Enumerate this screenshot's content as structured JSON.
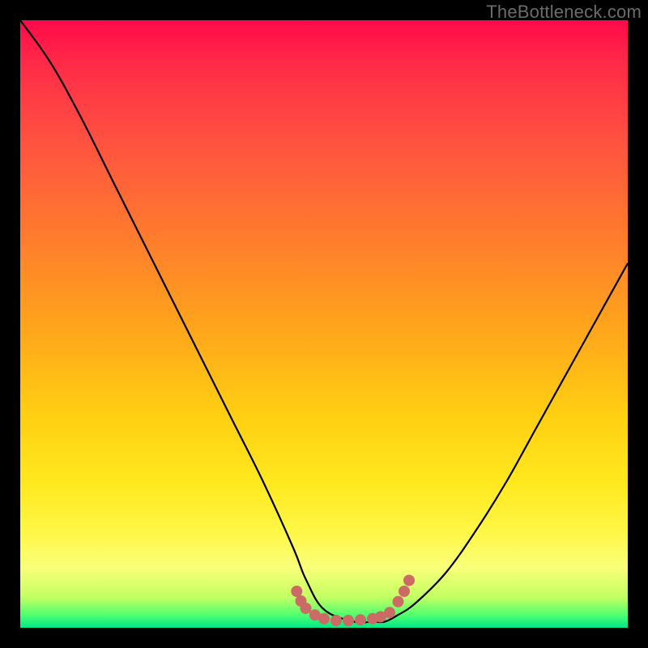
{
  "watermark": "TheBottleneck.com",
  "colors": {
    "curve": "#000000",
    "marker": "#cc6a66",
    "background_black": "#000000"
  },
  "chart_data": {
    "type": "line",
    "title": "",
    "xlabel": "",
    "ylabel": "",
    "xlim": [
      0,
      100
    ],
    "ylim": [
      0,
      100
    ],
    "grid": false,
    "legend": false,
    "series": [
      {
        "name": "bottleneck-curve",
        "x": [
          0,
          5,
          10,
          15,
          20,
          25,
          30,
          35,
          40,
          45,
          47,
          50,
          55,
          58,
          60,
          62,
          65,
          70,
          75,
          80,
          85,
          90,
          95,
          100
        ],
        "y": [
          100,
          93,
          84,
          74,
          64,
          54,
          44,
          34,
          24,
          13,
          8,
          3,
          1,
          1,
          1,
          2,
          4,
          9,
          16,
          24,
          33,
          42,
          51,
          60
        ]
      }
    ],
    "markers": {
      "name": "highlight-dots",
      "color": "#cc6a66",
      "points": [
        {
          "x": 45.5,
          "y": 6.0
        },
        {
          "x": 46.2,
          "y": 4.4
        },
        {
          "x": 47.0,
          "y": 3.2
        },
        {
          "x": 48.5,
          "y": 2.1
        },
        {
          "x": 50.0,
          "y": 1.5
        },
        {
          "x": 52.0,
          "y": 1.2
        },
        {
          "x": 54.0,
          "y": 1.2
        },
        {
          "x": 56.0,
          "y": 1.3
        },
        {
          "x": 58.0,
          "y": 1.5
        },
        {
          "x": 59.3,
          "y": 1.8
        },
        {
          "x": 60.8,
          "y": 2.5
        },
        {
          "x": 62.2,
          "y": 4.3
        },
        {
          "x": 63.2,
          "y": 6.0
        },
        {
          "x": 64.0,
          "y": 7.8
        }
      ]
    }
  }
}
